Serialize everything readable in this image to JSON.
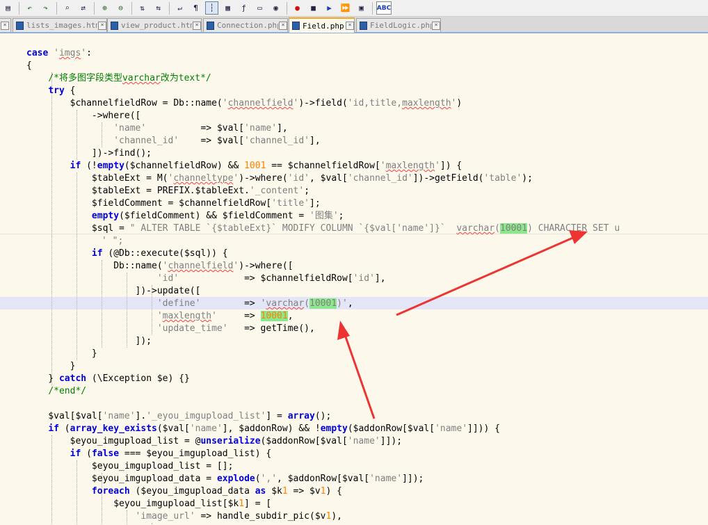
{
  "toolbar": {
    "icons": [
      "paste-icon",
      "undo-icon",
      "redo-icon",
      "find-icon",
      "replace-icon",
      "zoom-in-icon",
      "zoom-out-icon",
      "sync-vertical-icon",
      "sync-horizontal-icon",
      "word-wrap-icon",
      "show-all-chars-icon",
      "indent-guide-icon",
      "document-map-icon",
      "function-list-icon",
      "folder-workspace-icon",
      "monitor-icon",
      "record-macro-icon",
      "stop-macro-icon",
      "play-macro-icon",
      "run-macro-multiple-icon",
      "save-macro-icon",
      "spell-check-icon"
    ],
    "spellcheck_label": "ABC"
  },
  "tabs": [
    {
      "label": "lists_images.htm",
      "active": false
    },
    {
      "label": "view_product.htm",
      "active": false
    },
    {
      "label": "Connection.php",
      "active": false
    },
    {
      "label": "Field.php",
      "active": true
    },
    {
      "label": "FieldLogic.php",
      "active": false
    }
  ],
  "tab_close_glyph": "×",
  "code_lines": [
    "case 'imgs':",
    "{",
    "    /*将多图字段类型varchar改为text*/",
    "    try {",
    "        $channelfieldRow = Db::name('channelfield')->field('id,title,maxlength')",
    "            ->where([",
    "                'name'          => $val['name'],",
    "                'channel_id'    => $val['channel_id'],",
    "            ])->find();",
    "        if (!empty($channelfieldRow) && 1001 == $channelfieldRow['maxlength']) {",
    "            $tableExt = M('channeltype')->where('id', $val['channel_id'])->getField('table');",
    "            $tableExt = PREFIX.$tableExt.'_content';",
    "            $fieldComment = $channelfieldRow['title'];",
    "            empty($fieldComment) && $fieldComment = '图集';",
    "            $sql = \" ALTER TABLE `{$tableExt}` MODIFY COLUMN `{$val['name']}`  varchar(10001) CHARACTER SET u",
    "' \";",
    "            if (@Db::execute($sql)) {",
    "                Db::name('channelfield')->where([",
    "                        'id'            => $channelfieldRow['id'],",
    "                    ])->update([",
    "                        'define'        => 'varchar(10001)',",
    "                        'maxlength'     => 10001,",
    "                        'update_time'   => getTime(),",
    "                    ]);",
    "            }",
    "        }",
    "    } catch (\\Exception $e) {}",
    "    /*end*/",
    "",
    "    $val[$val['name'].'_eyou_imgupload_list'] = array();",
    "    if (array_key_exists($val['name'], $addonRow) && !empty($addonRow[$val['name']])) {",
    "        $eyou_imgupload_list = @unserialize($addonRow[$val['name']]);",
    "        if (false === $eyou_imgupload_list) {",
    "            $eyou_imgupload_list = [];",
    "            $eyou_imgupload_data = explode(',', $addonRow[$val['name']]);",
    "            foreach ($eyou_imgupload_data as $k1 => $v1) {",
    "                $eyou_imgupload_list[$k1] = [",
    "                    'image_url' => handle_subdir_pic($v1),"
  ],
  "highlight": {
    "marked_value": "10001",
    "current_line_index": 20
  },
  "colors": {
    "background": "#fcf9ec",
    "keyword": "#0000d8",
    "string": "#7f7f7f",
    "comment": "#008000",
    "number": "#ff8000",
    "mark": "#8de88d",
    "current_line": "#e4e5f6",
    "arrow": "#ee3333"
  }
}
